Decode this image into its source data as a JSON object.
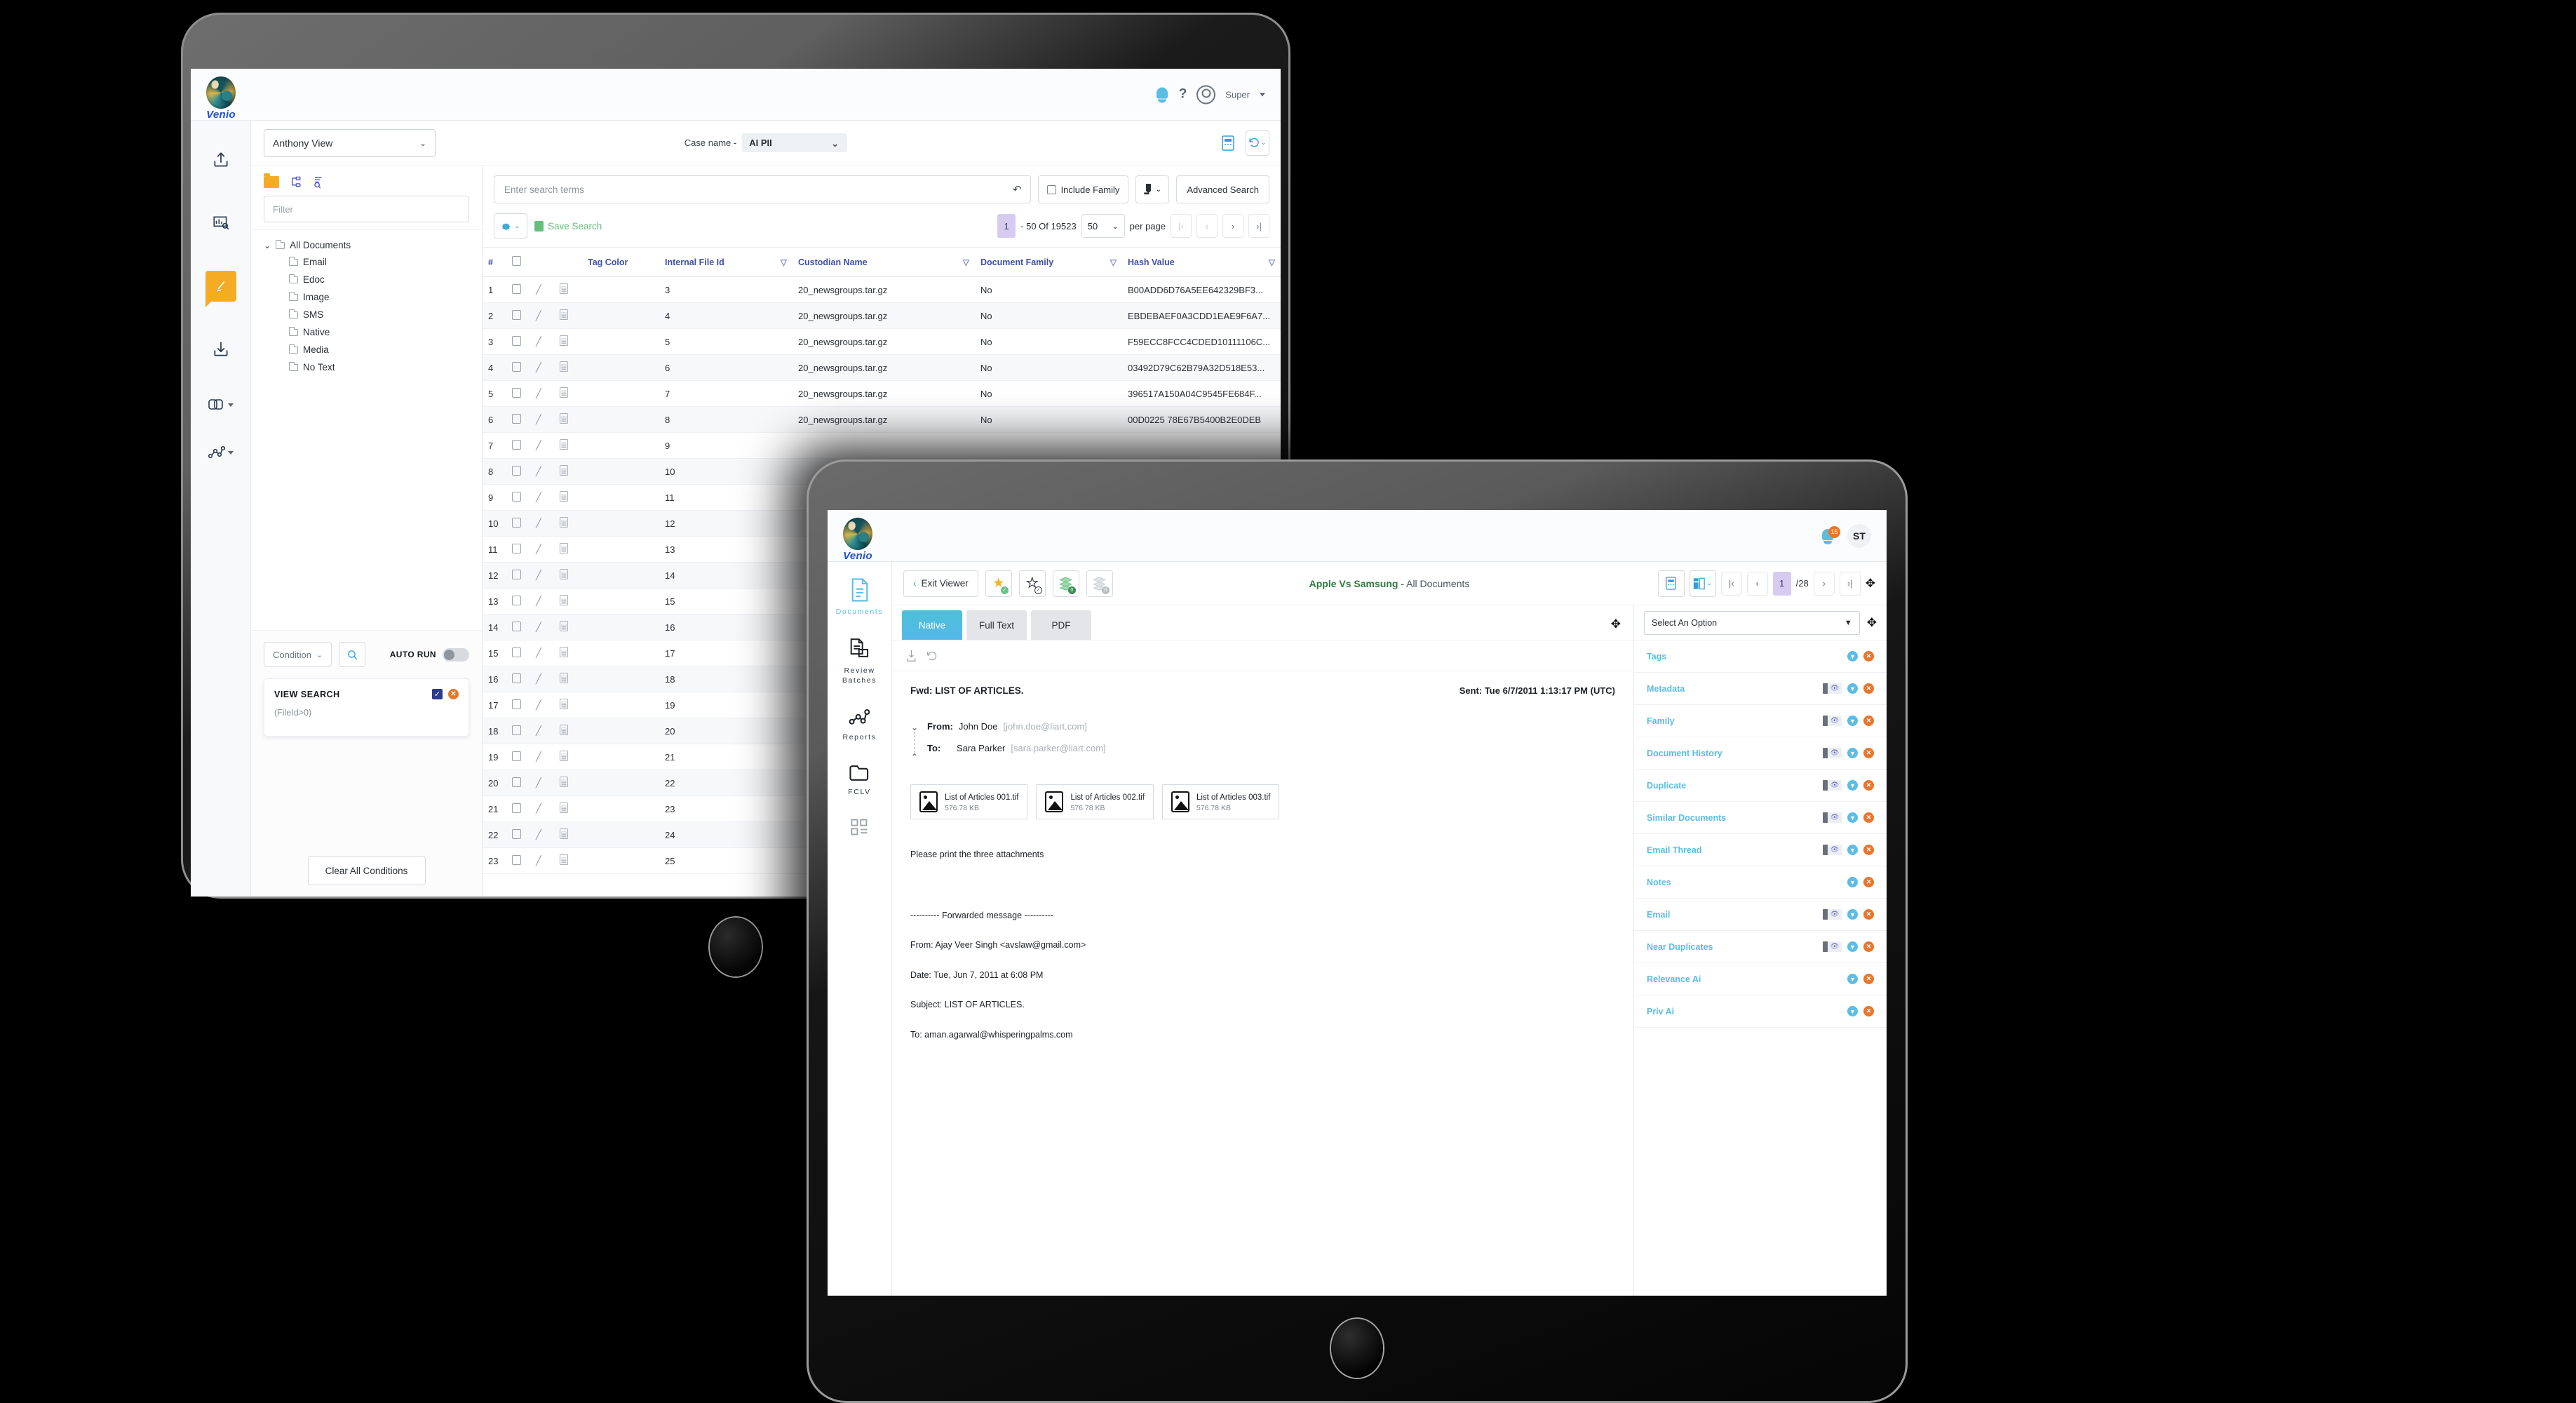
{
  "back_tablet": {
    "appbar": {
      "brand": "Venio",
      "bell_icon": "bell-icon",
      "help_label": "?",
      "user_label": "Super"
    },
    "view_select": {
      "value": "Anthony View"
    },
    "case": {
      "label": "Case name -",
      "value": "AI PII"
    },
    "left_rail": [
      {
        "name": "upload-icon"
      },
      {
        "name": "analytics-icon"
      },
      {
        "name": "review-icon"
      },
      {
        "name": "download-icon"
      },
      {
        "name": "link-icon"
      },
      {
        "name": "reports-icon"
      }
    ],
    "tree_tools": [
      {
        "name": "folder-icon"
      },
      {
        "name": "hierarchy-icon"
      },
      {
        "name": "search-tree-icon"
      }
    ],
    "filter": {
      "placeholder": "Filter"
    },
    "tree": {
      "root": "All Documents",
      "children": [
        "Email",
        "Edoc",
        "Image",
        "SMS",
        "Native",
        "Media",
        "No Text"
      ]
    },
    "conditions": {
      "condition_label": "Condition",
      "autorun_label": "AUTO RUN",
      "view_search_title": "VIEW SEARCH",
      "view_search_expr": "(FileId>0)",
      "clear_all_label": "Clear All Conditions"
    },
    "search": {
      "placeholder": "Enter search terms",
      "include_family_label": "Include Family",
      "advanced_search_label": "Advanced Search"
    },
    "toolbar": {
      "save_search_label": "Save Search",
      "page_number": "1",
      "range_label": "- 50 Of 19523",
      "per_page_value": "50",
      "per_page_label": "per page"
    },
    "grid": {
      "columns": [
        "#",
        "",
        "",
        "",
        "Tag Color",
        "Internal File Id",
        "Custodian Name",
        "Document Family",
        "Hash Value"
      ],
      "rows": [
        {
          "n": "1",
          "file_id": "3",
          "custodian": "20_newsgroups.tar.gz",
          "family": "No",
          "hash": "B00ADD6D76A5EE642329BF3..."
        },
        {
          "n": "2",
          "file_id": "4",
          "custodian": "20_newsgroups.tar.gz",
          "family": "No",
          "hash": "EBDEBAEF0A3CDD1EAE9F6A7..."
        },
        {
          "n": "3",
          "file_id": "5",
          "custodian": "20_newsgroups.tar.gz",
          "family": "No",
          "hash": "F59ECC8FCC4CDED10111106C..."
        },
        {
          "n": "4",
          "file_id": "6",
          "custodian": "20_newsgroups.tar.gz",
          "family": "No",
          "hash": "03492D79C62B79A32D518E53..."
        },
        {
          "n": "5",
          "file_id": "7",
          "custodian": "20_newsgroups.tar.gz",
          "family": "No",
          "hash": "396517A150A04C9545FE684F..."
        },
        {
          "n": "6",
          "file_id": "8",
          "custodian": "20_newsgroups.tar.gz",
          "family": "No",
          "hash": "00D0225 78E67B5400B2E0DEB"
        },
        {
          "n": "7",
          "file_id": "9",
          "custodian": "",
          "family": "",
          "hash": ""
        },
        {
          "n": "8",
          "file_id": "10",
          "custodian": "",
          "family": "",
          "hash": ""
        },
        {
          "n": "9",
          "file_id": "11",
          "custodian": "",
          "family": "",
          "hash": ""
        },
        {
          "n": "10",
          "file_id": "12",
          "custodian": "",
          "family": "",
          "hash": ""
        },
        {
          "n": "11",
          "file_id": "13",
          "custodian": "",
          "family": "",
          "hash": ""
        },
        {
          "n": "12",
          "file_id": "14",
          "custodian": "",
          "family": "",
          "hash": ""
        },
        {
          "n": "13",
          "file_id": "15",
          "custodian": "",
          "family": "",
          "hash": ""
        },
        {
          "n": "14",
          "file_id": "16",
          "custodian": "",
          "family": "",
          "hash": ""
        },
        {
          "n": "15",
          "file_id": "17",
          "custodian": "",
          "family": "",
          "hash": ""
        },
        {
          "n": "16",
          "file_id": "18",
          "custodian": "",
          "family": "",
          "hash": ""
        },
        {
          "n": "17",
          "file_id": "19",
          "custodian": "",
          "family": "",
          "hash": ""
        },
        {
          "n": "18",
          "file_id": "20",
          "custodian": "",
          "family": "",
          "hash": ""
        },
        {
          "n": "19",
          "file_id": "21",
          "custodian": "",
          "family": "",
          "hash": ""
        },
        {
          "n": "20",
          "file_id": "22",
          "custodian": "",
          "family": "",
          "hash": ""
        },
        {
          "n": "21",
          "file_id": "23",
          "custodian": "",
          "family": "",
          "hash": ""
        },
        {
          "n": "22",
          "file_id": "24",
          "custodian": "",
          "family": "",
          "hash": ""
        },
        {
          "n": "23",
          "file_id": "25",
          "custodian": "",
          "family": "",
          "hash": ""
        }
      ]
    }
  },
  "front_tablet": {
    "appbar": {
      "brand": "Venio",
      "notification_count": "15",
      "user_initials": "ST"
    },
    "left_rail": [
      {
        "label": "Documents",
        "icon": "document-icon",
        "active": true
      },
      {
        "label": "Review\nBatches",
        "icon": "review-batches-icon",
        "active": false
      },
      {
        "label": "Reports",
        "icon": "reports-icon",
        "active": false
      },
      {
        "label": "FCLV",
        "icon": "folder-icon",
        "active": false
      },
      {
        "label": "",
        "icon": "grid-icon",
        "active": false
      }
    ],
    "toolbar": {
      "exit_viewer_label": "Exit Viewer",
      "star_filled_icon": "star-tagged-icon",
      "star_outline_icon": "star-untagged-icon",
      "stack_green_icon": "stack-green-icon",
      "stack_grey_icon": "stack-grey-icon",
      "doc_title_case": "Apple Vs Samsung",
      "doc_title_sep": " - ",
      "doc_title_folder": "All Documents",
      "page_number": "1",
      "page_total": "/28"
    },
    "tabs": [
      {
        "label": "Native",
        "active": true
      },
      {
        "label": "Full Text",
        "active": false
      },
      {
        "label": "PDF",
        "active": false
      }
    ],
    "email": {
      "subject": "Fwd: LIST OF ARTICLES.",
      "sent": "Sent: Tue 6/7/2011 1:13:17 PM (UTC)",
      "from_label": "From:",
      "from_name": "John Doe",
      "from_mail": "[john.doe@liart.com]",
      "to_label": "To:",
      "to_name": "Sara Parker",
      "to_mail": "[sara.parker@liart.com]",
      "attachments": [
        {
          "name": "List of Articles 001.tif",
          "size": "576.78 KB"
        },
        {
          "name": "List of Articles 002.tif",
          "size": "576.78 KB"
        },
        {
          "name": "List of Articles 003.tif",
          "size": "576.78 KB"
        }
      ],
      "body": [
        "Please print the three attachments",
        "",
        "---------- Forwarded message ----------",
        "From: Ajay Veer Singh <avslaw@gmail.com>",
        "Date: Tue, Jun 7, 2011 at 6:08 PM",
        "Subject: LIST OF ARTICLES.",
        "To: aman.agarwal@whisperingpalms.com"
      ]
    },
    "side_panel": {
      "select_placeholder": "Select An Option",
      "items": [
        {
          "label": "Tags",
          "has_eye": false
        },
        {
          "label": "Metadata",
          "has_eye": true
        },
        {
          "label": "Family",
          "has_eye": true
        },
        {
          "label": "Document History",
          "has_eye": true
        },
        {
          "label": "Duplicate",
          "has_eye": true
        },
        {
          "label": "Similar Documents",
          "has_eye": true
        },
        {
          "label": "Email Thread",
          "has_eye": true
        },
        {
          "label": "Notes",
          "has_eye": false
        },
        {
          "label": "Email",
          "has_eye": true
        },
        {
          "label": "Near Duplicates",
          "has_eye": true
        },
        {
          "label": "Relevance Ai",
          "has_eye": false
        },
        {
          "label": "Priv Ai",
          "has_eye": false
        }
      ]
    }
  },
  "colors": {
    "brand_blue": "#1f4fd8",
    "accent_cyan": "#5bbde4",
    "accent_orange": "#e8762c",
    "accent_yellow": "#f5ac25",
    "accent_green": "#66bd7e",
    "header_purple": "#3f4fa8",
    "page_highlight": "#d6ccf2"
  }
}
